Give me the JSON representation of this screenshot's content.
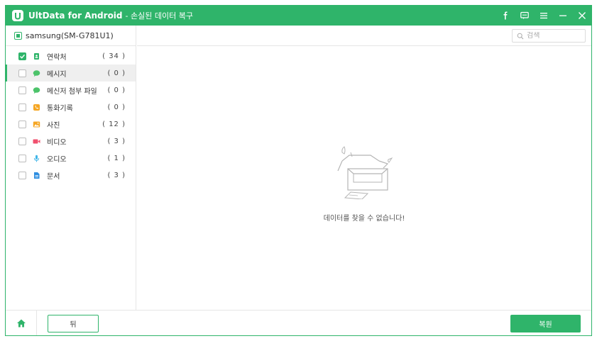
{
  "app": {
    "name": "UltData for Android",
    "subtitle": "- 손실된 데이터 복구"
  },
  "device": {
    "name": "samsung(SM-G781U1)"
  },
  "categories": [
    {
      "label": "연락처",
      "count": "( 34 )",
      "checked": true,
      "icon": "contacts-icon",
      "color": "#2fb46a"
    },
    {
      "label": "메시지",
      "count": "( 0 )",
      "checked": false,
      "icon": "message-icon",
      "color": "#4cc36a"
    },
    {
      "label": "메신저 첨부 파일",
      "count": "( 0 )",
      "checked": false,
      "icon": "messenger-icon",
      "color": "#4cc36a"
    },
    {
      "label": "통화기록",
      "count": "( 0 )",
      "checked": false,
      "icon": "call-log-icon",
      "color": "#f5a623"
    },
    {
      "label": "사진",
      "count": "( 12 )",
      "checked": false,
      "icon": "photo-icon",
      "color": "#f5a623"
    },
    {
      "label": "비디오",
      "count": "( 3 )",
      "checked": false,
      "icon": "video-icon",
      "color": "#f0506e"
    },
    {
      "label": "오디오",
      "count": "( 1 )",
      "checked": false,
      "icon": "audio-icon",
      "color": "#3fb5e8"
    },
    {
      "label": "문서",
      "count": "( 3 )",
      "checked": false,
      "icon": "document-icon",
      "color": "#2f8ee0"
    }
  ],
  "search": {
    "placeholder": "검색"
  },
  "main": {
    "empty_message": "데이터를 찾을 수 없습니다!"
  },
  "footer": {
    "back_label": "뒤",
    "restore_label": "복원"
  },
  "colors": {
    "accent": "#2fb46a"
  }
}
